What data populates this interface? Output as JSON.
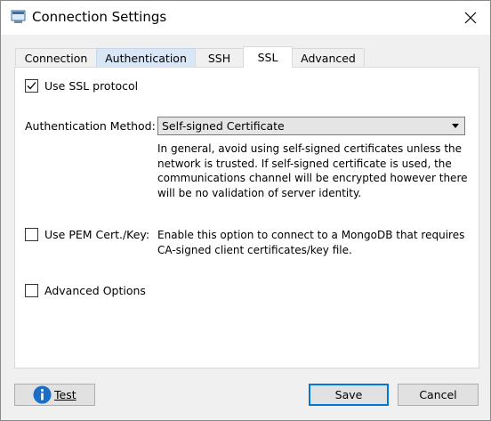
{
  "window": {
    "title": "Connection Settings"
  },
  "tabs": [
    {
      "label": "Connection"
    },
    {
      "label": "Authentication"
    },
    {
      "label": "SSH"
    },
    {
      "label": "SSL"
    },
    {
      "label": "Advanced"
    }
  ],
  "ssl": {
    "use_ssl_label": "Use SSL protocol",
    "use_ssl_checked": true,
    "auth_method_label": "Authentication Method:",
    "auth_method_value": "Self-signed Certificate",
    "auth_desc_lines": [
      "In general, avoid using self-signed certificates unless the",
      "network is trusted. If self-signed certificate is used, the",
      "communications channel will be encrypted however there",
      "will be no validation of server identity."
    ],
    "use_pem_label": "Use PEM Cert./Key:",
    "use_pem_checked": false,
    "pem_desc_lines": [
      "Enable this option to connect to a MongoDB that requires",
      "CA-signed client certificates/key file."
    ],
    "advanced_options_label": "Advanced Options",
    "advanced_options_checked": false
  },
  "footer": {
    "test_label": "Test",
    "save_label": "Save",
    "cancel_label": "Cancel"
  },
  "colors": {
    "accent": "#0078d7",
    "tab_hover": "#d8e6f5",
    "info_icon": "#1a6fc4"
  }
}
